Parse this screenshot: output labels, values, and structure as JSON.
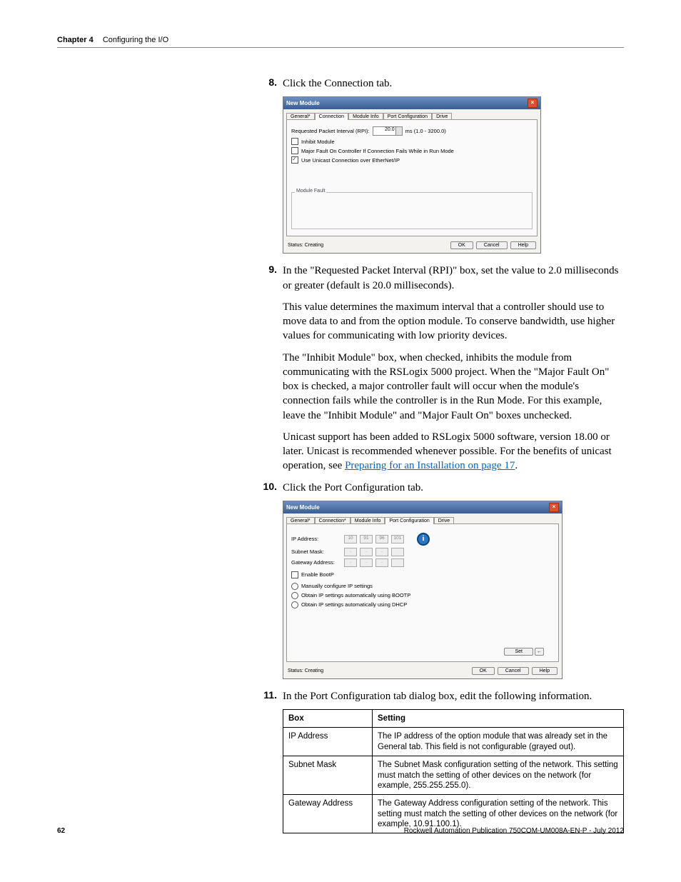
{
  "header": {
    "chapter": "Chapter 4",
    "title": "Configuring the I/O"
  },
  "steps": {
    "s8": {
      "num": "8.",
      "text": "Click the Connection tab."
    },
    "s9": {
      "num": "9.",
      "text": "In the \"Requested Packet Interval (RPI)\" box, set the value to 2.0 milliseconds or greater (default is 20.0 milliseconds)."
    },
    "s10": {
      "num": "10.",
      "text": "Click the Port Configuration tab."
    },
    "s11": {
      "num": "11.",
      "text": "In the Port Configuration tab dialog box, edit the following information."
    }
  },
  "paras": {
    "p1": "This value determines the maximum interval that a controller should use to move data to and from the option module. To conserve bandwidth, use higher values for communicating with low priority devices.",
    "p2": "The \"Inhibit Module\" box, when checked, inhibits the module from communicating with the RSLogix 5000 project. When the \"Major Fault On\" box is checked, a major controller fault will occur when the module's connection fails while the controller is in the Run Mode. For this example, leave the \"Inhibit Module\" and \"Major Fault On\" boxes unchecked.",
    "p3_a": "Unicast support has been added to RSLogix 5000 software, version 18.00 or later. Unicast is recommended whenever possible. For the benefits of unicast operation, see ",
    "p3_link": "Preparing for an Installation on page 17",
    "p3_b": "."
  },
  "dialog1": {
    "title": "New Module",
    "tabs": [
      "General*",
      "Connection",
      "Module Info",
      "Port Configuration",
      "Drive"
    ],
    "activeTab": "Connection",
    "rpi_label": "Requested Packet Interval (RPI):",
    "rpi_value": "20.0",
    "rpi_unit": "ms  (1.0 - 3200.0)",
    "cb1": "Inhibit Module",
    "cb2": "Major Fault On Controller If Connection Fails While in Run Mode",
    "cb3": "Use Unicast Connection over EtherNet/IP",
    "fieldset": "Module Fault",
    "status": "Status: Creating",
    "ok": "OK",
    "cancel": "Cancel",
    "help": "Help"
  },
  "dialog2": {
    "title": "New Module",
    "tabs": [
      "General*",
      "Connection*",
      "Module Info",
      "Port Configuration",
      "Drive"
    ],
    "activeTab": "Port Configuration",
    "ip_label": "IP Address:",
    "ip": [
      "10",
      "91",
      "96",
      "101"
    ],
    "subnet_label": "Subnet Mask:",
    "gateway_label": "Gateway Address:",
    "enable_bootp": "Enable BootP",
    "r1": "Manually configure IP settings",
    "r2": "Obtain IP settings automatically using BOOTP",
    "r3": "Obtain IP settings automatically using DHCP",
    "set": "Set",
    "status": "Status: Creating",
    "ok": "OK",
    "cancel": "Cancel",
    "help": "Help"
  },
  "table": {
    "h1": "Box",
    "h2": "Setting",
    "rows": [
      {
        "c1": "IP Address",
        "c2": "The IP address of the option module that was already set in the General tab. This field is not configurable (grayed out)."
      },
      {
        "c1": "Subnet Mask",
        "c2": "The Subnet Mask configuration setting of the network. This setting must match the setting of other devices on the network (for example, 255.255.255.0)."
      },
      {
        "c1": "Gateway Address",
        "c2": "The Gateway Address configuration setting of the network. This setting must match the setting of other devices on the network (for example, 10.91.100.1)."
      }
    ]
  },
  "footer": {
    "page": "62",
    "pub": "Rockwell Automation Publication 750COM-UM008A-EN-P - July 2012"
  }
}
